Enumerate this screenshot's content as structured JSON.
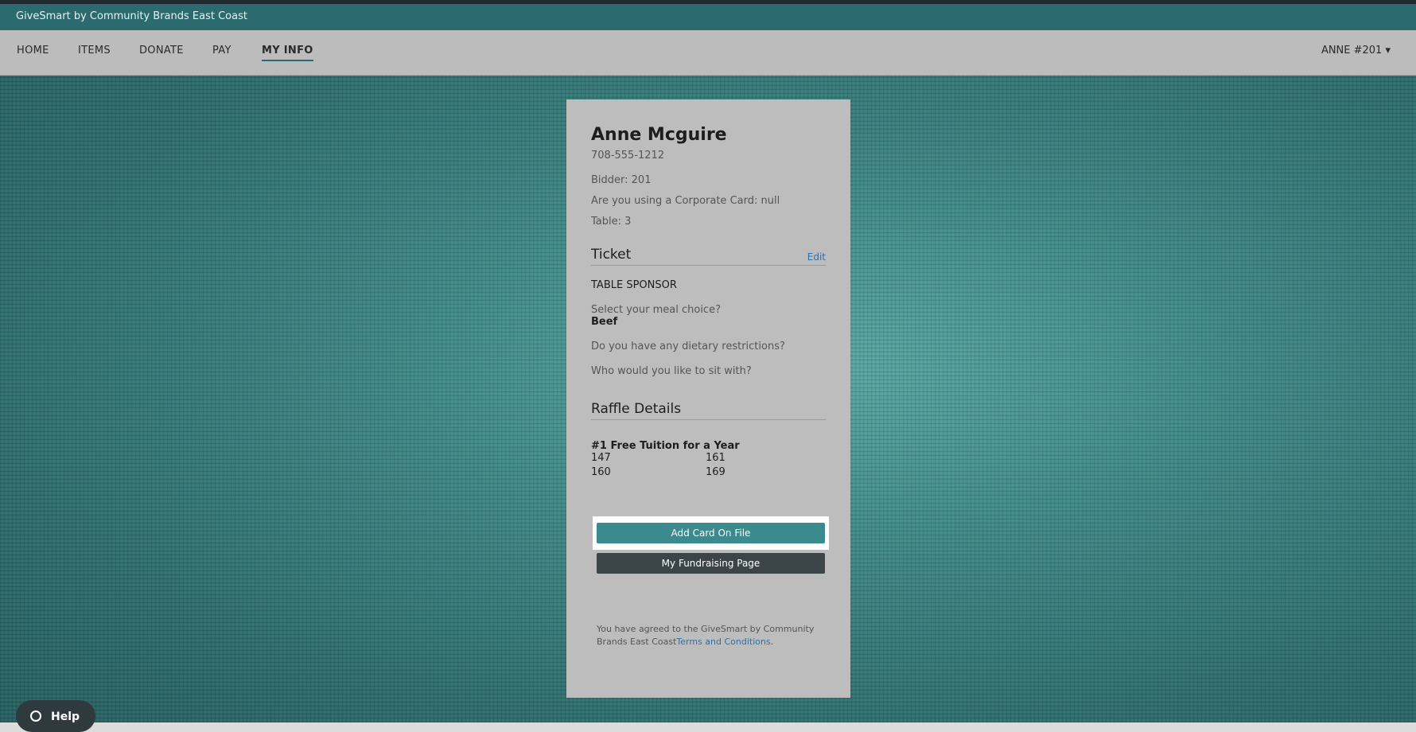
{
  "topbar": {
    "org": "GiveSmart by Community Brands East Coast"
  },
  "nav": {
    "items": [
      "HOME",
      "ITEMS",
      "DONATE",
      "PAY",
      "MY INFO"
    ],
    "active": "MY INFO",
    "user": "ANNE  #201 ▾"
  },
  "profile": {
    "name": "Anne Mcguire",
    "phone": "708-555-1212",
    "bidder": "Bidder: 201",
    "corporate_card": "Are you using a Corporate Card: null",
    "table": "Table: 3"
  },
  "ticket": {
    "heading": "Ticket",
    "edit_label": "Edit",
    "type": "TABLE SPONSOR",
    "questions": [
      {
        "q": "Select your meal choice?",
        "a": "Beef"
      },
      {
        "q": "Do you have any dietary restrictions?",
        "a": ""
      },
      {
        "q": "Who would you like to sit with?",
        "a": ""
      }
    ]
  },
  "raffle": {
    "heading": "Raffle Details",
    "item": "#1 Free Tuition for a Year",
    "numbers": [
      "147",
      "161",
      "160",
      "169"
    ]
  },
  "buttons": {
    "add_card": "Add Card On File",
    "fundraising": "My Fundraising Page"
  },
  "footer": {
    "text": "You have agreed to the GiveSmart by Community Brands East Coast",
    "link": "Terms and Conditions",
    "end": "."
  },
  "help": {
    "label": "Help"
  },
  "colors": {
    "brand": "#2b6a6e",
    "primary_button": "#3a8a8e",
    "dark_button": "#3b4446",
    "link": "#2f6ea6"
  }
}
